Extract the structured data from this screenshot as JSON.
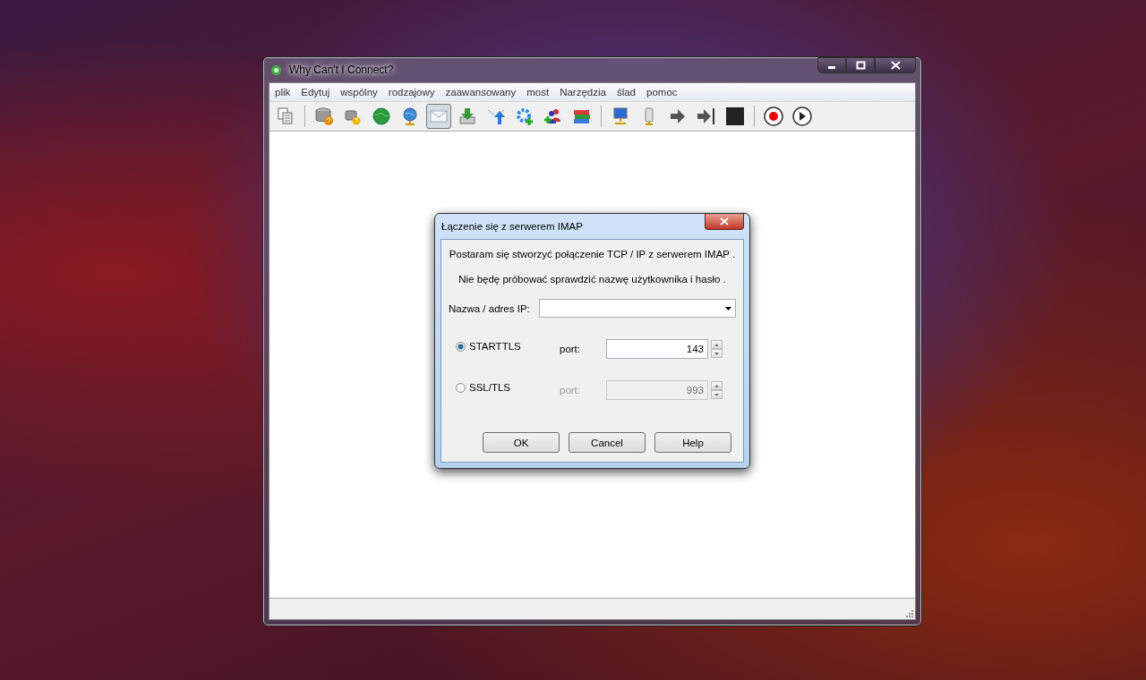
{
  "window": {
    "title": "Why Can't I Connect?"
  },
  "menu": [
    "plik",
    "Edytuj",
    "wspólny",
    "rodzajowy",
    "zaawansowany",
    "most",
    "Narzędzia",
    "ślad",
    "pomoc"
  ],
  "toolbar": [
    [
      {
        "kind": "documents",
        "pressed": false
      }
    ],
    [
      {
        "kind": "database-help",
        "pressed": false
      },
      {
        "kind": "database-help-small",
        "pressed": false
      },
      {
        "kind": "globe-green",
        "pressed": false
      },
      {
        "kind": "globe-blue",
        "pressed": false
      },
      {
        "kind": "envelope",
        "pressed": true
      },
      {
        "kind": "download",
        "pressed": false
      },
      {
        "kind": "upload",
        "pressed": false
      },
      {
        "kind": "gear-plus",
        "pressed": false
      },
      {
        "kind": "users-plus",
        "pressed": false
      },
      {
        "kind": "books",
        "pressed": false
      }
    ],
    [
      {
        "kind": "monitor",
        "pressed": false
      },
      {
        "kind": "server",
        "pressed": false
      },
      {
        "kind": "arrow",
        "pressed": false
      },
      {
        "kind": "arrow-bar",
        "pressed": false
      },
      {
        "kind": "stop",
        "pressed": false
      }
    ],
    [
      {
        "kind": "record",
        "pressed": false
      },
      {
        "kind": "play",
        "pressed": false
      }
    ]
  ],
  "dialog": {
    "title": "Łączenie się z serwerem IMAP",
    "messages": [
      "Postaram się stworzyć połączenie TCP / IP z serwerem IMAP .",
      "Nie będę próbować sprawdzić nazwę użytkownika i hasło ."
    ],
    "host_label": "Nazwa / adres IP:",
    "options": [
      {
        "label": "STARTTLS",
        "selected": true,
        "port_label": "port:",
        "port": "143"
      },
      {
        "label": "SSL/TLS",
        "selected": false,
        "port_label": "port:",
        "port": "993"
      }
    ],
    "buttons": [
      "OK",
      "Cancel",
      "Help"
    ]
  }
}
